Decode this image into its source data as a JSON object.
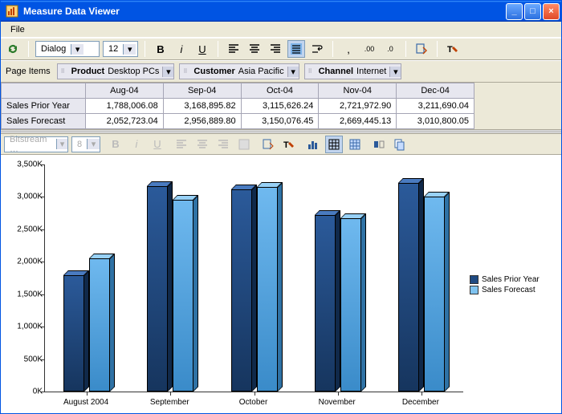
{
  "window": {
    "title": "Measure Data Viewer"
  },
  "menu": {
    "file": "File"
  },
  "toolbar1": {
    "font_family": "Dialog",
    "font_size": "12"
  },
  "page_items": {
    "label": "Page Items",
    "filters": [
      {
        "dim": "Product",
        "val": "Desktop PCs"
      },
      {
        "dim": "Customer",
        "val": "Asia Pacific"
      },
      {
        "dim": "Channel",
        "val": "Internet"
      }
    ]
  },
  "table": {
    "columns": [
      "Aug-04",
      "Sep-04",
      "Oct-04",
      "Nov-04",
      "Dec-04"
    ],
    "rows": [
      {
        "label": "Sales Prior Year",
        "values": [
          "1,788,006.08",
          "3,168,895.82",
          "3,115,626.24",
          "2,721,972.90",
          "3,211,690.04"
        ]
      },
      {
        "label": "Sales Forecast",
        "values": [
          "2,052,723.04",
          "2,956,889.80",
          "3,150,076.45",
          "2,669,445.13",
          "3,010,800.05"
        ]
      }
    ]
  },
  "chart_toolbar": {
    "font_family": "Bitstream …",
    "font_size": "8"
  },
  "legend": {
    "s1": "Sales Prior Year",
    "s2": "Sales Forecast"
  },
  "chart_data": {
    "type": "bar",
    "categories": [
      "August 2004",
      "September",
      "October",
      "November",
      "December"
    ],
    "series": [
      {
        "name": "Sales Prior Year",
        "values": [
          1788006,
          3168896,
          3115626,
          2721973,
          3211690
        ]
      },
      {
        "name": "Sales Forecast",
        "values": [
          2052723,
          2956890,
          3150076,
          2669445,
          3010800
        ]
      }
    ],
    "ylabel_format": "K",
    "ylim": [
      0,
      3500000
    ],
    "yticks": [
      0,
      500,
      1000,
      1500,
      2000,
      2500,
      3000,
      3500
    ],
    "ytick_labels": [
      "0K",
      "500K",
      "1,000K",
      "1,500K",
      "2,000K",
      "2,500K",
      "3,000K",
      "3,500K"
    ]
  }
}
